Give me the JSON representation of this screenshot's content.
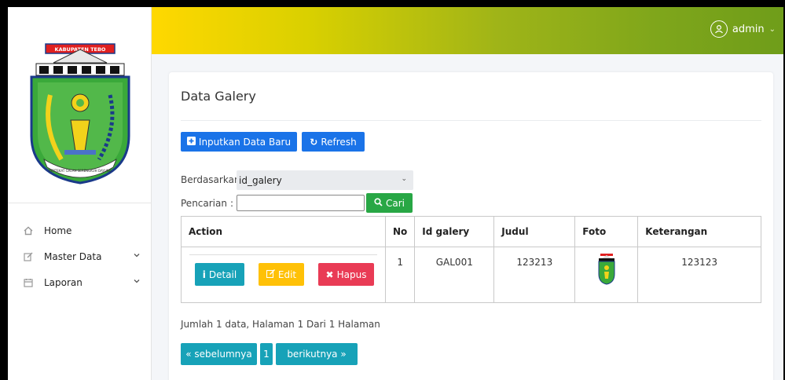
{
  "header": {
    "username": "admin"
  },
  "logo": {
    "banner_text": "KABUPATEN TEBO",
    "motto": "BERTEKAT GALAH SERENGKUH DAYUNG"
  },
  "sidebar": {
    "items": [
      {
        "label": "Home",
        "icon": "home-icon"
      },
      {
        "label": "Master Data",
        "icon": "edit-icon",
        "has_submenu": true
      },
      {
        "label": "Laporan",
        "icon": "calendar-icon",
        "has_submenu": true
      }
    ]
  },
  "main": {
    "title": "Data Galery",
    "buttons": {
      "add": "Inputkan Data Baru",
      "refresh": "Refresh"
    },
    "filter": {
      "by_label": "Berdasarkan:",
      "by_value": "id_galery",
      "search_label": "Pencarian",
      "search_colon": ":",
      "search_value": "",
      "search_button": "Cari"
    },
    "table": {
      "headers": [
        "Action",
        "No",
        "Id galery",
        "Judul",
        "Foto",
        "Keterangan"
      ],
      "rows": [
        {
          "no": "1",
          "id_galery": "GAL001",
          "judul": "123213",
          "keterangan": "123123",
          "actions": {
            "detail": "Detail",
            "edit": "Edit",
            "delete": "Hapus"
          }
        }
      ]
    },
    "summary": "Jumlah 1 data, Halaman 1 Dari 1 Halaman",
    "pagination": {
      "prev": "« sebelumnya",
      "current": "1",
      "next": "berikutnya »"
    }
  },
  "colors": {
    "primary": "#1a73e8",
    "info": "#17a2b8",
    "warning": "#ffc107",
    "danger": "#e93b55",
    "success": "#28a745",
    "header_start": "#ffd800",
    "header_end": "#6f9d1a"
  }
}
